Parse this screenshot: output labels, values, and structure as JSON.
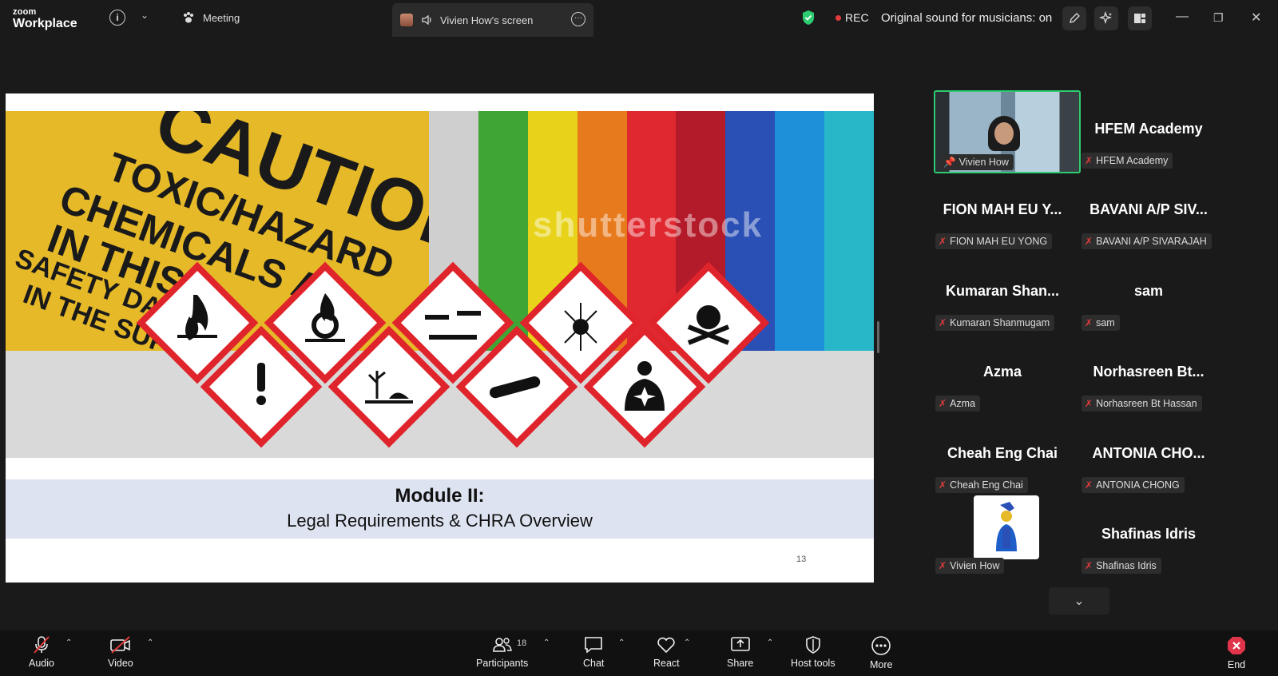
{
  "app": {
    "brand_line1": "zoom",
    "brand_line2": "Workplace"
  },
  "topbar": {
    "meeting_label": "Meeting",
    "screen_tab_label": "Vivien How's screen",
    "rec_label": "REC",
    "sound_label": "Original sound for musicians: on"
  },
  "slide": {
    "title": "Module II:",
    "subtitle": "Legal Requirements & CHRA Overview",
    "page_number": "13",
    "sign_lines": [
      "CAUTION",
      "TOXIC/HAZARD",
      "CHEMICALS A",
      "IN THIS A",
      "SAFETY DATA",
      "IN THE SUP"
    ],
    "watermark": "shutterstock",
    "ghs_pictograms": [
      "flame-icon",
      "flame-over-circle-icon",
      "corrosion-icon",
      "exploding-bomb-icon",
      "skull-crossbones-icon",
      "exclamation-icon",
      "environment-icon",
      "gas-cylinder-icon",
      "health-hazard-icon"
    ]
  },
  "participants": [
    {
      "name": "HFEM Academy",
      "tag": "HFEM Academy"
    },
    {
      "name": "FION MAH EU Y...",
      "tag": "FION MAH EU YONG"
    },
    {
      "name": "BAVANI A/P SIV...",
      "tag": "BAVANI A/P SIVARAJAH"
    },
    {
      "name": "Kumaran Shan...",
      "tag": "Kumaran Shanmugam"
    },
    {
      "name": "sam",
      "tag": "sam"
    },
    {
      "name": "Azma",
      "tag": "Azma"
    },
    {
      "name": "Norhasreen Bt...",
      "tag": "Norhasreen Bt Hassan"
    },
    {
      "name": "Cheah Eng Chai",
      "tag": "Cheah Eng Chai"
    },
    {
      "name": "ANTONIA CHO...",
      "tag": "ANTONIA CHONG"
    },
    {
      "name": "Shafinas Idris",
      "tag": "Shafinas Idris"
    }
  ],
  "self_video": {
    "tag": "Vivien How"
  },
  "self_avatar": {
    "tag": "Vivien How"
  },
  "toolbar": {
    "audio": "Audio",
    "video": "Video",
    "participants": "Participants",
    "participants_count": "18",
    "chat": "Chat",
    "react": "React",
    "share": "Share",
    "host_tools": "Host tools",
    "more": "More",
    "end": "End"
  },
  "colors": {
    "accent_green": "#2ecc71",
    "rec_red": "#e23b3b",
    "end_red": "#e0344a",
    "slide_band": "#dde3f0",
    "sign_yellow": "#e6b928",
    "ghs_red": "#e0242b"
  }
}
